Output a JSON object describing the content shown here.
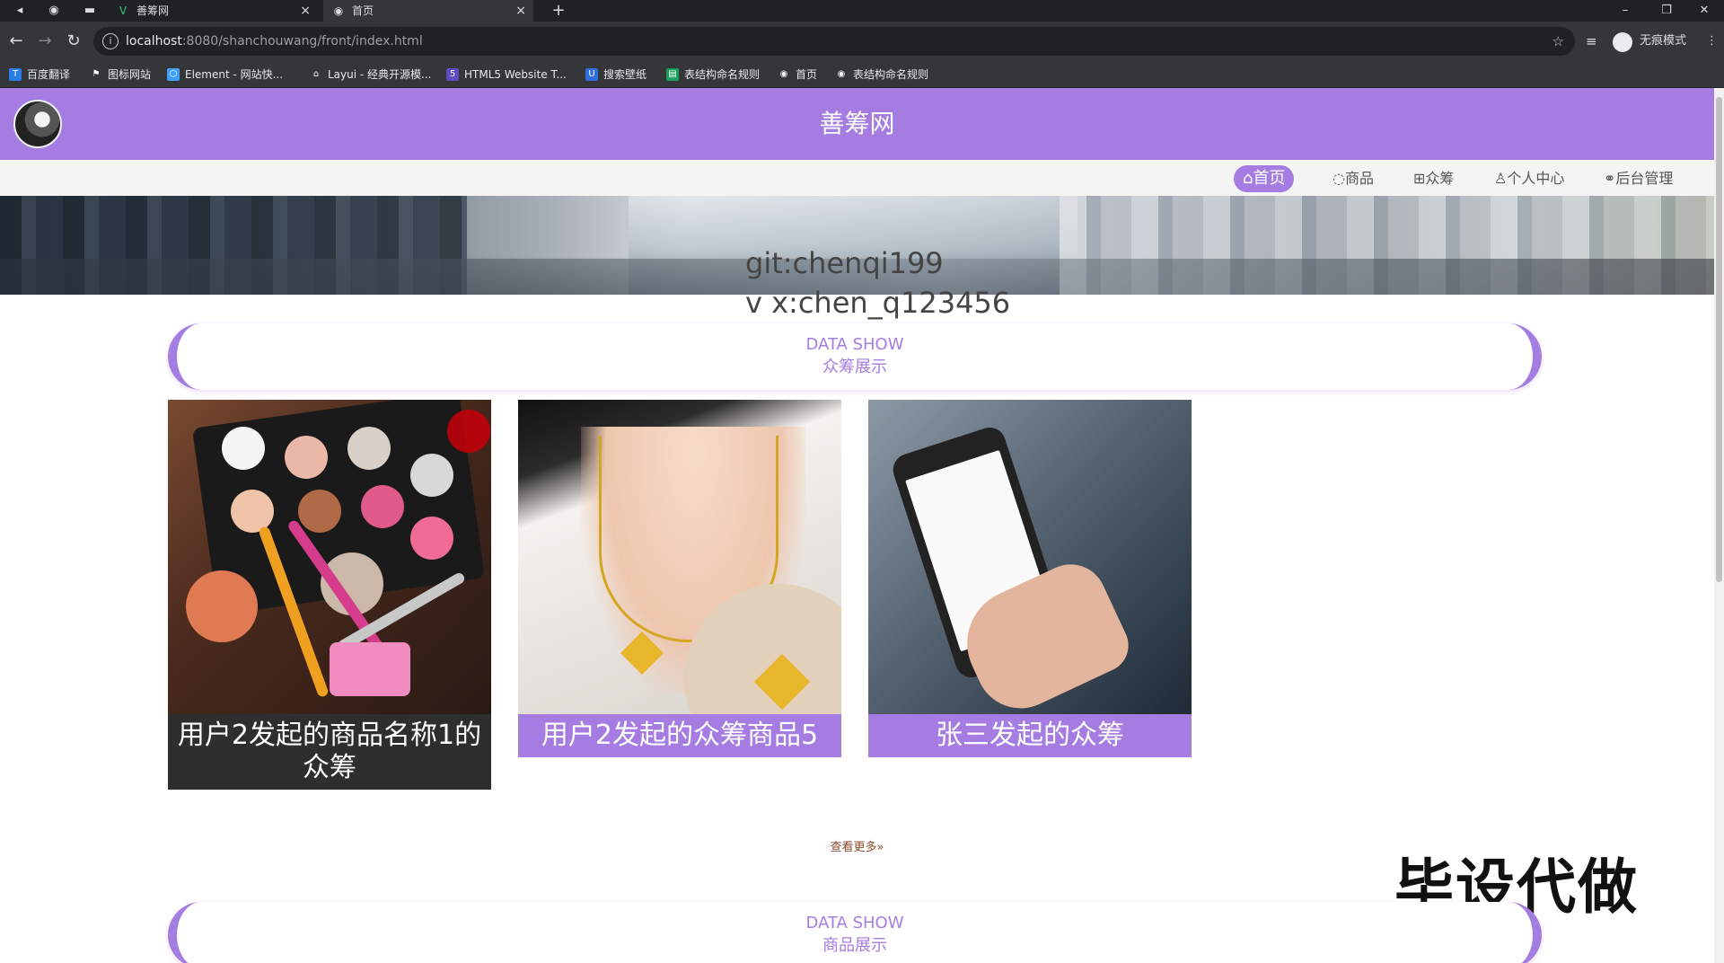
{
  "browser": {
    "tabs": [
      {
        "title": "善筹网",
        "icon": "vue-icon"
      },
      {
        "title": "首页",
        "icon": "globe-icon"
      }
    ],
    "url_host": "localhost",
    "url_path": ":8080/shanchouwang/front/index.html",
    "profile_label": "无痕模式",
    "bookmarks": [
      "百度翻译",
      "图标网站",
      "Element - 网站快...",
      "Layui - 经典开源模...",
      "HTML5 Website T...",
      "搜索壁纸",
      "表结构命名规则",
      "首页",
      "表结构命名规则"
    ]
  },
  "site": {
    "title": "善筹网",
    "nav": [
      {
        "label": "首页",
        "icon": "home-icon",
        "active": true
      },
      {
        "label": "商品",
        "icon": "palette-icon",
        "active": false
      },
      {
        "label": "众筹",
        "icon": "grid-icon",
        "active": false
      },
      {
        "label": "个人中心",
        "icon": "user-icon",
        "active": false
      },
      {
        "label": "后台管理",
        "icon": "link-icon",
        "active": false
      }
    ]
  },
  "watermark": {
    "line1": "git:chenqi199",
    "line2": "v x:chen_q123456"
  },
  "section1": {
    "en": "DATA SHOW",
    "cn": "众筹展示"
  },
  "cards": [
    {
      "title": "用户2发起的商品名称1的众筹"
    },
    {
      "title": "用户2发起的众筹商品5"
    },
    {
      "title": "张三发起的众筹"
    }
  ],
  "see_more": "查看更多»",
  "section2": {
    "en": "DATA SHOW",
    "cn": "商品展示"
  },
  "overlay": "毕设代做",
  "colors": {
    "accent": "#a57de2",
    "header_bg": "#a57de2",
    "nav_bg": "#f4f4f4",
    "dark_card": "#2e2e2e"
  }
}
